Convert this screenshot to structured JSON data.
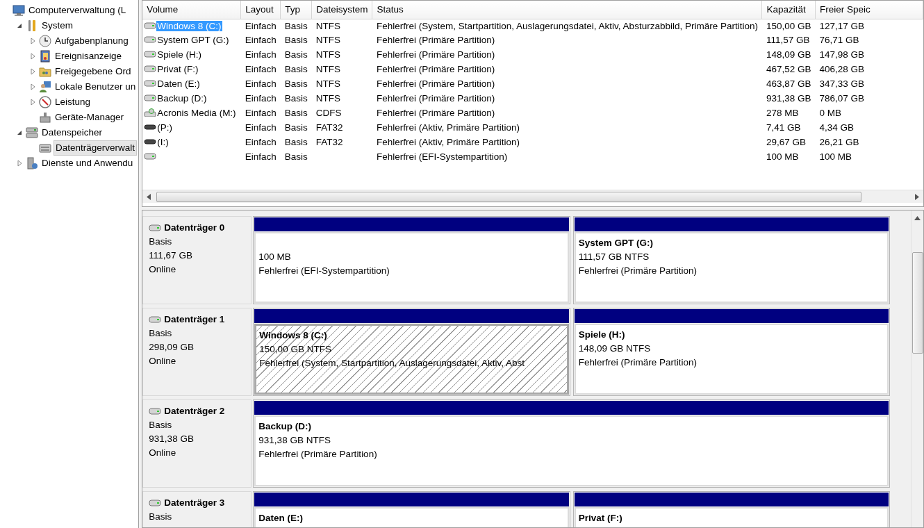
{
  "tree": [
    {
      "label": "Computerverwaltung (L",
      "selected": false,
      "children": [
        {
          "label": "System",
          "expanded": true,
          "selected": false,
          "children": [
            {
              "label": "Aufgabenplanung",
              "expanded": false,
              "selected": false
            },
            {
              "label": "Ereignisanzeige",
              "expanded": false,
              "selected": false
            },
            {
              "label": "Freigegebene Ord",
              "expanded": false,
              "selected": false
            },
            {
              "label": "Lokale Benutzer un",
              "expanded": false,
              "selected": false
            },
            {
              "label": "Leistung",
              "expanded": false,
              "selected": false
            },
            {
              "label": "Geräte-Manager",
              "selected": false
            }
          ]
        },
        {
          "label": "Datenspeicher",
          "expanded": true,
          "selected": false,
          "children": [
            {
              "label": "Datenträgerverwalt",
              "selected": true
            }
          ]
        },
        {
          "label": "Dienste und Anwendu",
          "expanded": false,
          "selected": false
        }
      ]
    }
  ],
  "volumes": {
    "columns": [
      "Volume",
      "Layout",
      "Typ",
      "Dateisystem",
      "Status",
      "Kapazität",
      "Freier Speic"
    ],
    "rows": [
      {
        "kind": "disk",
        "selected": true,
        "cells": [
          "Windows 8 (C:)",
          "Einfach",
          "Basis",
          "NTFS",
          "Fehlerfrei (System, Startpartition, Auslagerungsdatei, Aktiv, Absturzabbild, Primäre Partition)",
          "150,00 GB",
          "127,17 GB"
        ]
      },
      {
        "kind": "disk",
        "selected": false,
        "cells": [
          "System GPT (G:)",
          "Einfach",
          "Basis",
          "NTFS",
          "Fehlerfrei (Primäre Partition)",
          "111,57 GB",
          "76,71 GB"
        ]
      },
      {
        "kind": "disk",
        "selected": false,
        "cells": [
          "Spiele (H:)",
          "Einfach",
          "Basis",
          "NTFS",
          "Fehlerfrei (Primäre Partition)",
          "148,09 GB",
          "147,98 GB"
        ]
      },
      {
        "kind": "disk",
        "selected": false,
        "cells": [
          "Privat (F:)",
          "Einfach",
          "Basis",
          "NTFS",
          "Fehlerfrei (Primäre Partition)",
          "467,52 GB",
          "406,28 GB"
        ]
      },
      {
        "kind": "disk",
        "selected": false,
        "cells": [
          "Daten (E:)",
          "Einfach",
          "Basis",
          "NTFS",
          "Fehlerfrei (Primäre Partition)",
          "463,87 GB",
          "347,33 GB"
        ]
      },
      {
        "kind": "disk",
        "selected": false,
        "cells": [
          "Backup (D:)",
          "Einfach",
          "Basis",
          "NTFS",
          "Fehlerfrei (Primäre Partition)",
          "931,38 GB",
          "786,07 GB"
        ]
      },
      {
        "kind": "cd",
        "selected": false,
        "cells": [
          "Acronis Media (M:)",
          "Einfach",
          "Basis",
          "CDFS",
          "Fehlerfrei (Primäre Partition)",
          "278 MB",
          "0 MB"
        ]
      },
      {
        "kind": "removable",
        "selected": false,
        "cells": [
          "(P:)",
          "Einfach",
          "Basis",
          "FAT32",
          "Fehlerfrei (Aktiv, Primäre Partition)",
          "7,41 GB",
          "4,34 GB"
        ]
      },
      {
        "kind": "removable",
        "selected": false,
        "cells": [
          "(I:)",
          "Einfach",
          "Basis",
          "FAT32",
          "Fehlerfrei (Aktiv, Primäre Partition)",
          "29,67 GB",
          "26,21 GB"
        ]
      },
      {
        "kind": "disk",
        "selected": false,
        "cells": [
          "",
          "Einfach",
          "Basis",
          "",
          "Fehlerfrei (EFI-Systempartition)",
          "100 MB",
          "100 MB"
        ]
      }
    ]
  },
  "disks": [
    {
      "name": "Datenträger 0",
      "lines": [
        "Basis",
        "111,67 GB",
        "Online"
      ],
      "partitions": [
        {
          "lines": [
            "100 MB",
            "Fehlerfrei (EFI-Systempartition)"
          ],
          "selected": false
        },
        {
          "title": "System GPT  (G:)",
          "lines": [
            "111,57 GB NTFS",
            "Fehlerfrei (Primäre Partition)"
          ],
          "selected": false
        }
      ]
    },
    {
      "name": "Datenträger 1",
      "lines": [
        "Basis",
        "298,09 GB",
        "Online"
      ],
      "partitions": [
        {
          "title": "Windows 8  (C:)",
          "lines": [
            "150,00 GB NTFS",
            "Fehlerfrei (System, Startpartition, Auslagerungsdatei, Aktiv, Abst"
          ],
          "selected": true
        },
        {
          "title": "Spiele  (H:)",
          "lines": [
            "148,09 GB NTFS",
            "Fehlerfrei (Primäre Partition)"
          ],
          "selected": false
        }
      ]
    },
    {
      "name": "Datenträger 2",
      "lines": [
        "Basis",
        "931,38 GB",
        "Online"
      ],
      "partitions": [
        {
          "title": "Backup  (D:)",
          "lines": [
            "931,38 GB NTFS",
            "Fehlerfrei (Primäre Partition)"
          ],
          "selected": false
        }
      ]
    },
    {
      "name": "Datenträger 3",
      "lines": [
        "Basis"
      ],
      "partitions": [
        {
          "title": "Daten  (E:)",
          "selected": false
        },
        {
          "title": "Privat  (F:)",
          "selected": false
        }
      ]
    }
  ]
}
